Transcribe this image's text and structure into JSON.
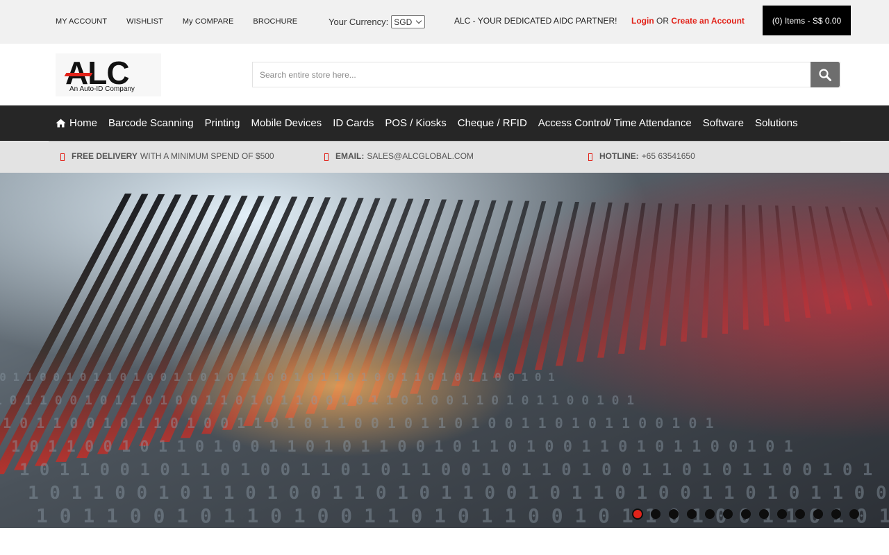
{
  "topbar": {
    "links": [
      "MY ACCOUNT",
      "WISHLIST",
      "My COMPARE",
      "BROCHURE"
    ],
    "currency_label": "Your Currency:",
    "currency_value": "SGD",
    "tagline": "ALC - YOUR DEDICATED AIDC PARTNER!",
    "login_label": "Login",
    "or_label": " OR ",
    "create_account_label": "Create an Account",
    "cart_label": "(0) Items - S$ 0.00"
  },
  "header": {
    "logo_text": "ALC",
    "logo_subtitle": "An Auto-ID Company",
    "search_placeholder": "Search entire store here..."
  },
  "nav": {
    "items": [
      "Home",
      "Barcode Scanning",
      "Printing",
      "Mobile Devices",
      "ID Cards",
      "POS / Kiosks",
      "Cheque / RFID",
      "Access Control/ Time Attendance",
      "Software",
      "Solutions"
    ]
  },
  "info": {
    "delivery_bold": "FREE DELIVERY",
    "delivery_text": "WITH A MINIMUM SPEND OF $500",
    "email_bold": "EMAIL:",
    "email_text": "SALES@ALCGLOBAL.COM",
    "hotline_bold": "HOTLINE:",
    "hotline_text": "+65 63541650"
  },
  "slider": {
    "slide_count": 13,
    "active_slide": 1
  },
  "colors": {
    "accent": "#e2231a",
    "nav_bg": "#262626",
    "topbar_bg": "#f1f1f1",
    "strip_bg": "#e3e3e3"
  }
}
